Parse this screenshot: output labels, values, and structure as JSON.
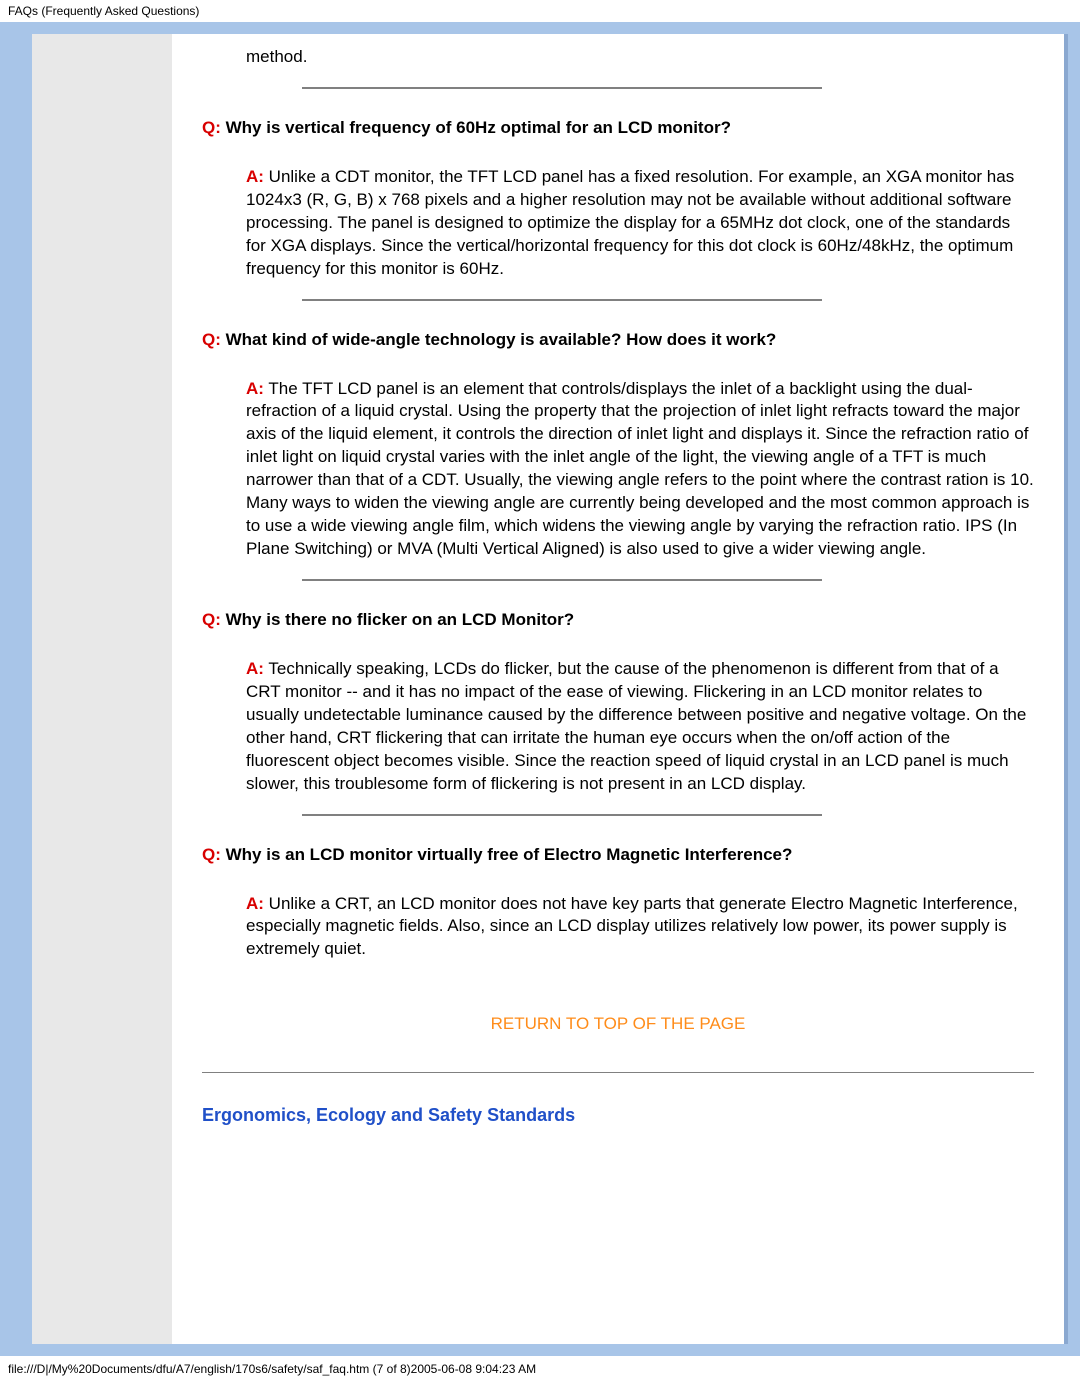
{
  "header": {
    "text": "FAQs (Frequently Asked Questions)"
  },
  "fragment_method": "method.",
  "faqs": [
    {
      "q_prefix": "Q:",
      "q_text": " Why is vertical frequency of 60Hz optimal for an LCD monitor?",
      "a_prefix": "A:",
      "a_text": " Unlike a CDT monitor, the TFT LCD panel has a fixed resolution. For example, an XGA monitor has 1024x3 (R, G, B) x 768 pixels and a higher resolution may not be available without additional software processing. The panel is designed to optimize the display for a 65MHz dot clock, one of the standards for XGA displays. Since the vertical/horizontal frequency for this dot clock is 60Hz/48kHz, the optimum frequency for this monitor is 60Hz."
    },
    {
      "q_prefix": "Q:",
      "q_text": " What kind of wide-angle technology is available? How does it work?",
      "a_prefix": "A:",
      "a_text": " The TFT LCD panel is an element that controls/displays the inlet of a backlight using the dual-refraction of a liquid crystal. Using the property that the projection of inlet light refracts toward the major axis of the liquid element, it controls the direction of inlet light and displays it. Since the refraction ratio of inlet light on liquid crystal varies with the inlet angle of the light, the viewing angle of a TFT is much narrower than that of a CDT. Usually, the viewing angle refers to the point where the contrast ration is 10. Many ways to widen the viewing angle are currently being developed and the most common approach is to use a wide viewing angle film, which widens the viewing angle by varying the refraction ratio. IPS (In Plane Switching) or MVA (Multi Vertical Aligned) is also used to give a wider viewing angle."
    },
    {
      "q_prefix": "Q:",
      "q_text": " Why is there no flicker on an LCD Monitor?",
      "a_prefix": "A:",
      "a_text": " Technically speaking, LCDs do flicker, but the cause of the phenomenon is different from that of a CRT monitor -- and it has no impact of the ease of viewing. Flickering in an LCD monitor relates to usually undetectable luminance caused by the difference between positive and negative voltage. On the other hand, CRT flickering that can irritate the human eye occurs when the on/off action of the fluorescent object becomes visible. Since the reaction speed of liquid crystal in an LCD panel is much slower, this troublesome form of flickering is not present in an LCD display."
    },
    {
      "q_prefix": "Q:",
      "q_text": " Why is an LCD monitor virtually free of Electro Magnetic Interference?",
      "a_prefix": "A:",
      "a_text": " Unlike a CRT, an LCD monitor does not have key parts that generate Electro Magnetic Interference, especially magnetic fields. Also, since an LCD display utilizes relatively low power, its power supply is extremely quiet."
    }
  ],
  "return_link": "RETURN TO TOP OF THE PAGE",
  "section_title": "Ergonomics, Ecology and Safety Standards",
  "footer": {
    "path": "file:///D|/My%20Documents/dfu/A7/english/170s6/safety/saf_faq.htm (7 of 8)2005-06-08 9:04:23 AM"
  }
}
